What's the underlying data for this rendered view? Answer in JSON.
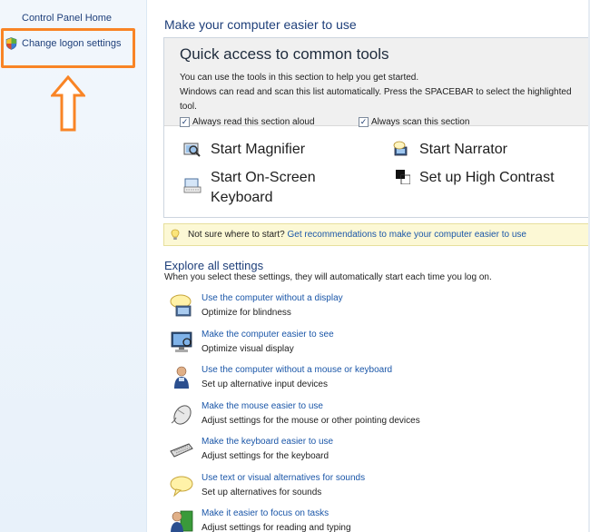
{
  "left_pane": {
    "home_link": "Control Panel Home",
    "logon_link": "Change logon settings"
  },
  "colors": {
    "highlight_box": "#f98425",
    "link": "#1a56a8",
    "tip_bg": "#fcf8d5"
  },
  "main": {
    "title": "Make your computer easier to use",
    "quick_access": {
      "heading": "Quick access to common tools",
      "line1": "You can use the tools in this section to help you get started.",
      "line2": "Windows can read and scan this list automatically.  Press the SPACEBAR to select the highlighted tool.",
      "check_read": "Always read this section aloud",
      "check_scan": "Always scan this section",
      "tools": [
        {
          "label": "Start Magnifier",
          "icon": "magnifier-icon"
        },
        {
          "label": "Start Narrator",
          "icon": "narrator-icon"
        },
        {
          "label": "Start On-Screen Keyboard",
          "icon": "onscreen-keyboard-icon"
        },
        {
          "label": "Set up High Contrast",
          "icon": "high-contrast-icon"
        }
      ]
    },
    "tip": {
      "question": "Not sure where to start?",
      "link": "Get recommendations to make your computer easier to use"
    },
    "explore": {
      "title": "Explore all settings",
      "subtitle": "When you select these settings, they will automatically start each time you log on.",
      "items": [
        {
          "link": "Use the computer without a display",
          "desc": "Optimize for blindness",
          "icon": "speech-bubble-display-icon"
        },
        {
          "link": "Make the computer easier to see",
          "desc": "Optimize visual display",
          "icon": "monitor-icon"
        },
        {
          "link": "Use the computer without a mouse or keyboard",
          "desc": "Set up alternative input devices",
          "icon": "person-icon"
        },
        {
          "link": "Make the mouse easier to use",
          "desc": "Adjust settings for the mouse or other pointing devices",
          "icon": "mouse-icon"
        },
        {
          "link": "Make the keyboard easier to use",
          "desc": "Adjust settings for the keyboard",
          "icon": "keyboard-icon"
        },
        {
          "link": "Use text or visual alternatives for sounds",
          "desc": "Set up alternatives for sounds",
          "icon": "speech-bubble-icon"
        },
        {
          "link": "Make it easier to focus on tasks",
          "desc": "Adjust settings for reading and typing",
          "icon": "focus-tasks-icon"
        }
      ]
    }
  }
}
